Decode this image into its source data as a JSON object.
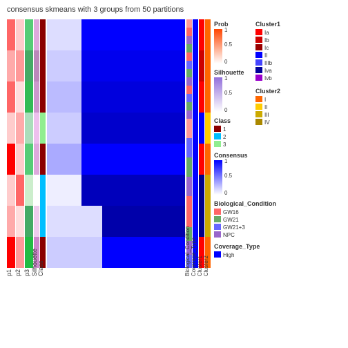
{
  "title": "consensus skmeans with 3 groups from 50 partitions",
  "chart": {
    "main_heatmap": {
      "rows": 8,
      "cols": 8,
      "description": "Consensus clustering heatmap"
    },
    "left_annotations": [
      "p1",
      "p2",
      "p3",
      "Silhouette",
      "Class"
    ],
    "right_annotations": [
      "Biological_Condition",
      "Coverage_Type",
      "Cluster1",
      "Cluster2"
    ],
    "xlabels": [
      "p1",
      "p2",
      "p3",
      "Silhouette",
      "Class"
    ],
    "ylabels": [
      "Biological_Condition",
      "Coverage_Type",
      "Cluster1",
      "Cluster2"
    ]
  },
  "legends": {
    "prob": {
      "title": "Prob",
      "values": [
        "1",
        "0.5",
        "0"
      ],
      "gradient_start": "#FF4500",
      "gradient_end": "#FFFFFF"
    },
    "silhouette": {
      "title": "Silhouette",
      "values": [
        "1",
        "0.5",
        "0"
      ],
      "gradient_start": "#9370DB",
      "gradient_end": "#FFFFFF"
    },
    "class": {
      "title": "Class",
      "items": [
        {
          "label": "1",
          "color": "#8B0000"
        },
        {
          "label": "2",
          "color": "#00BFFF"
        },
        {
          "label": "3",
          "color": "#90EE90"
        }
      ]
    },
    "consensus": {
      "title": "Consensus",
      "values": [
        "1",
        "0.5",
        "0"
      ],
      "gradient_start": "#0000FF",
      "gradient_end": "#FFFFFF"
    },
    "biological_condition": {
      "title": "Biological_Condition",
      "items": [
        {
          "label": "GW16",
          "color": "#FF6666"
        },
        {
          "label": "GW21",
          "color": "#66AA66"
        },
        {
          "label": "GW21+3",
          "color": "#6666FF"
        },
        {
          "label": "NPC",
          "color": "#AA44AA"
        }
      ]
    },
    "cluster1": {
      "title": "Cluster1",
      "items": [
        {
          "label": "Ia",
          "color": "#FF0000"
        },
        {
          "label": "Ib",
          "color": "#CC0000"
        },
        {
          "label": "Ic",
          "color": "#990000"
        },
        {
          "label": "II",
          "color": "#0000FF"
        },
        {
          "label": "IIIb",
          "color": "#4444FF"
        },
        {
          "label": "IVa",
          "color": "#000099"
        },
        {
          "label": "IVb",
          "color": "#9900CC"
        }
      ]
    },
    "cluster2": {
      "title": "Cluster2",
      "items": [
        {
          "label": "I",
          "color": "#FF6600"
        },
        {
          "label": "II",
          "color": "#FFCC00"
        },
        {
          "label": "III",
          "color": "#CCAA00"
        },
        {
          "label": "IV",
          "color": "#AA8800"
        }
      ]
    },
    "coverage_type": {
      "title": "Coverage_Type",
      "items": [
        {
          "label": "High",
          "color": "#0000FF"
        }
      ]
    }
  }
}
